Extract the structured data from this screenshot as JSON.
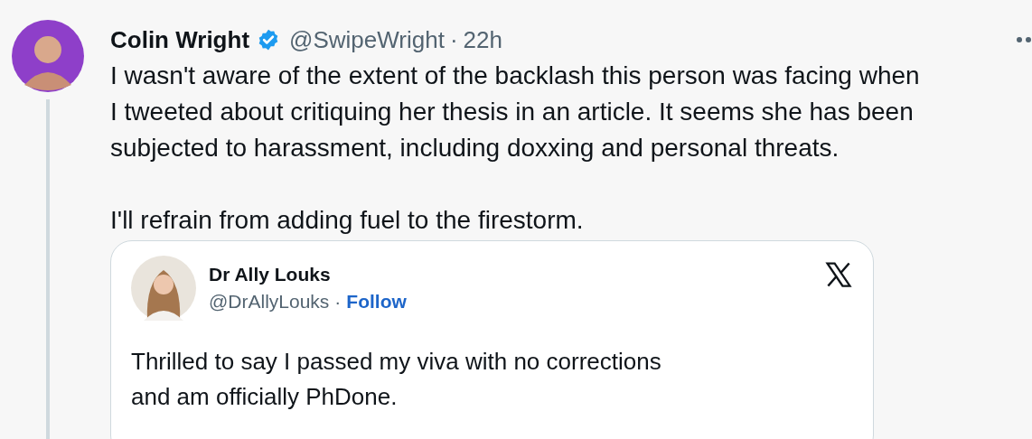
{
  "tweet": {
    "author_name": "Colin Wright",
    "verified": true,
    "handle": "@SwipeWright",
    "separator": "·",
    "time": "22h",
    "paragraphs": [
      "I wasn't aware of the extent of the backlash this person was facing when I tweeted about critiquing her thesis in an article. It seems she has been subjected to harassment, including doxxing and personal threats.",
      "I'll refrain from adding fuel to the firestorm."
    ]
  },
  "embedded_tweet": {
    "author_name": "Dr Ally Louks",
    "handle": "@DrAllyLouks",
    "separator": "·",
    "follow": "Follow",
    "text": "Thrilled to say I passed my viva with no corrections and am officially PhDone."
  }
}
